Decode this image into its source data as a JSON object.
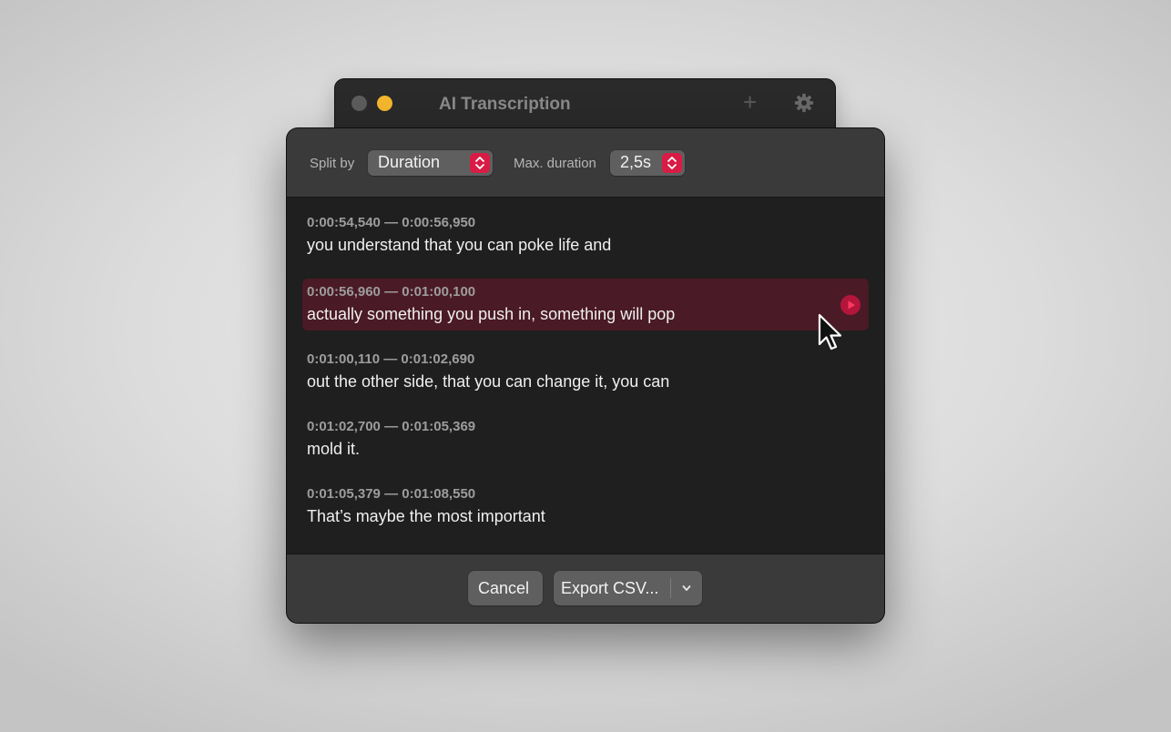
{
  "background_window": {
    "title": "AI Transcription",
    "add_icon": "plus-icon",
    "settings_icon": "gear-icon"
  },
  "toolbar": {
    "split_by_label": "Split by",
    "split_by_value": "Duration",
    "max_duration_label": "Max. duration",
    "max_duration_value": "2,5s"
  },
  "segments": [
    {
      "timestamp": "0:00:54,540 — 0:00:56,950",
      "text": "you understand that you can poke life and",
      "selected": false
    },
    {
      "timestamp": "0:00:56,960 — 0:01:00,100",
      "text": "actually something you push in, something will pop",
      "selected": true
    },
    {
      "timestamp": "0:01:00,110 — 0:01:02,690",
      "text": "out the other side, that you can change it, you can",
      "selected": false
    },
    {
      "timestamp": "0:01:02,700 — 0:01:05,369",
      "text": "mold it.",
      "selected": false
    },
    {
      "timestamp": "0:01:05,379 — 0:01:08,550",
      "text": "That’s maybe the most important",
      "selected": false
    }
  ],
  "footer": {
    "cancel_label": "Cancel",
    "export_label": "Export CSV..."
  },
  "colors": {
    "accent": "#d91c45",
    "selected_row": "#4a1a26",
    "minimize": "#f5b72d"
  }
}
